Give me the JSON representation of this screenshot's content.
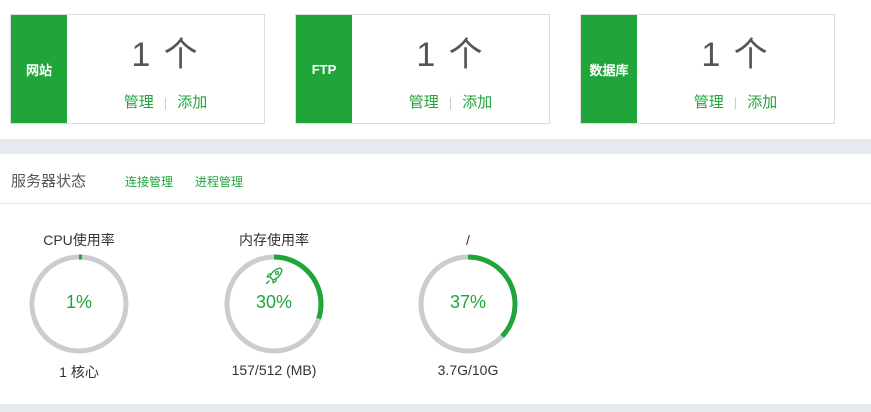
{
  "cards": [
    {
      "tag": "网站",
      "count": "1 个",
      "manage": "管理",
      "sep": "|",
      "add": "添加"
    },
    {
      "tag": "FTP",
      "count": "1 个",
      "manage": "管理",
      "sep": "|",
      "add": "添加"
    },
    {
      "tag": "数据库",
      "count": "1 个",
      "manage": "管理",
      "sep": "|",
      "add": "添加"
    }
  ],
  "status": {
    "title": "服务器状态",
    "links": [
      "连接管理",
      "进程管理"
    ]
  },
  "gauges": [
    {
      "title": "CPU使用率",
      "percent": "1%",
      "value": 0.01,
      "sub": "1 核心"
    },
    {
      "title": "内存使用率",
      "percent": "30%",
      "value": 0.3,
      "sub": "157/512 (MB)",
      "icon": "rocket-icon"
    },
    {
      "title": "/",
      "percent": "37%",
      "value": 0.37,
      "sub": "3.7G/10G"
    }
  ],
  "colors": {
    "accent": "#20a53a",
    "track": "#cccccc"
  }
}
